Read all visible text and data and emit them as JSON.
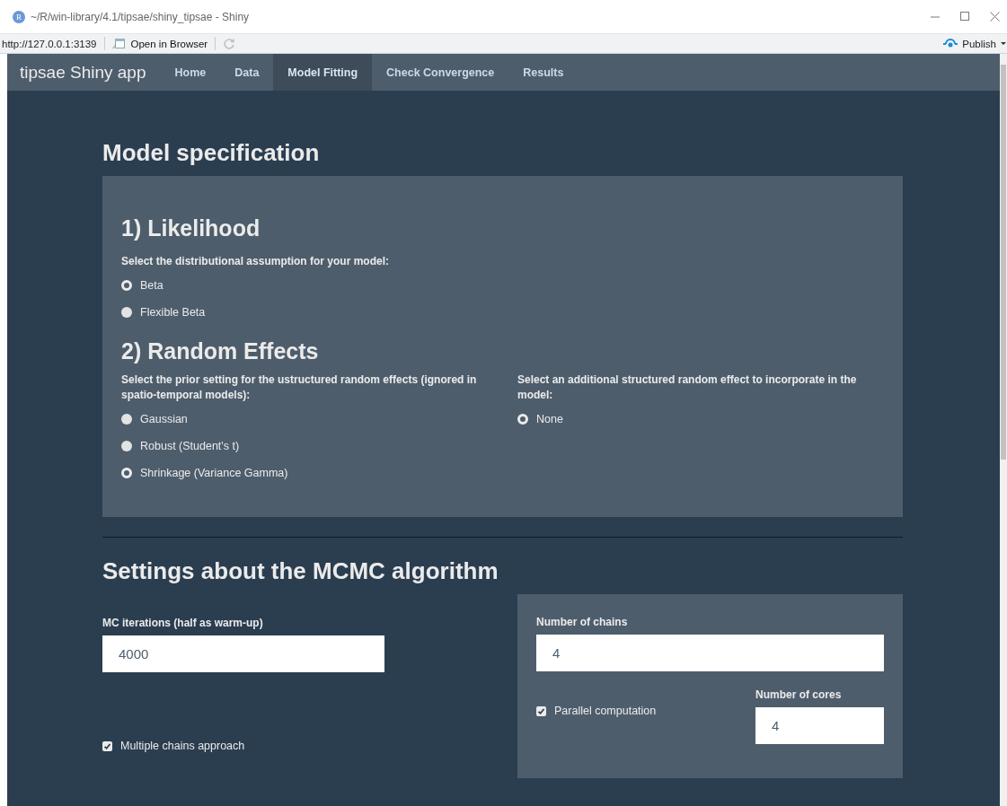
{
  "window": {
    "icon_letter": "R",
    "title": "~/R/win-library/4.1/tipsae/shiny_tipsae - Shiny",
    "url": "http://127.0.0.1:3139",
    "open_in_browser": "Open in Browser",
    "publish": "Publish"
  },
  "navbar": {
    "brand": "tipsae Shiny app",
    "tabs": [
      {
        "label": "Home",
        "selected": false
      },
      {
        "label": "Data",
        "selected": false
      },
      {
        "label": "Model Fitting",
        "selected": true
      },
      {
        "label": "Check Convergence",
        "selected": false
      },
      {
        "label": "Results",
        "selected": false
      }
    ]
  },
  "model_specification": {
    "title": "Model specification",
    "likelihood": {
      "title": "1) Likelihood",
      "label": "Select the distributional assumption for your model:",
      "options": [
        {
          "label": "Beta",
          "selected": true
        },
        {
          "label": "Flexible Beta",
          "selected": false
        }
      ]
    },
    "random_effects": {
      "title": "2) Random Effects",
      "unstructured": {
        "label": "Select the prior setting for the ustructured random effects (ignored in spatio-temporal models):",
        "options": [
          {
            "label": "Gaussian",
            "selected": false
          },
          {
            "label": "Robust (Student's t)",
            "selected": false
          },
          {
            "label": "Shrinkage (Variance Gamma)",
            "selected": true
          }
        ]
      },
      "structured": {
        "label": "Select an additional structured random effect to incorporate in the model:",
        "options": [
          {
            "label": "None",
            "selected": true
          }
        ]
      }
    }
  },
  "mcmc": {
    "title": "Settings about the MCMC algorithm",
    "iterations": {
      "label": "MC iterations (half as warm-up)",
      "value": "4000"
    },
    "multiple_chains": {
      "label": "Multiple chains approach",
      "checked": true
    },
    "chains": {
      "label": "Number of chains",
      "value": "4"
    },
    "parallel": {
      "label": "Parallel computation",
      "checked": true
    },
    "cores": {
      "label": "Number of cores",
      "value": "4"
    }
  }
}
